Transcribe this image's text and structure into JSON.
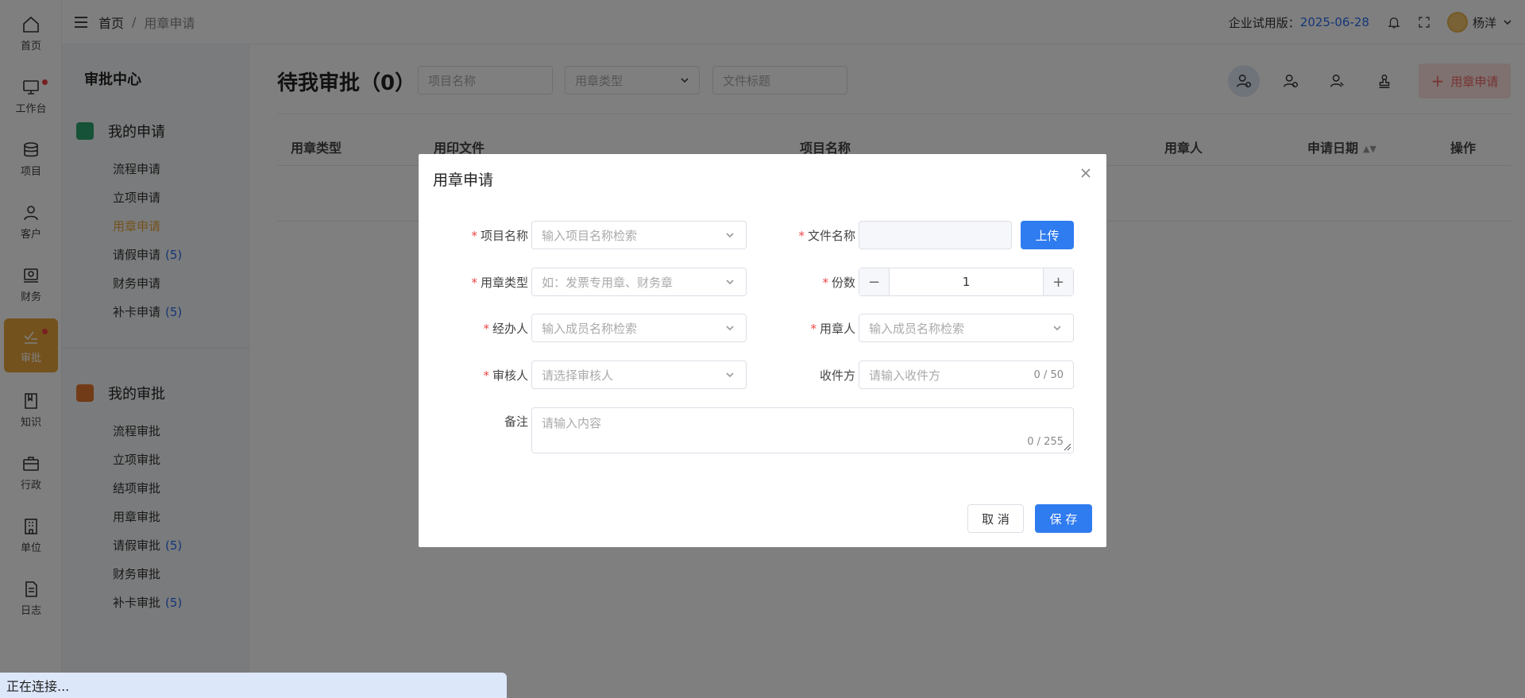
{
  "rail": {
    "items": [
      {
        "label": "首页",
        "icon": "home-icon"
      },
      {
        "label": "工作台",
        "icon": "monitor-icon"
      },
      {
        "label": "项目",
        "icon": "database-icon"
      },
      {
        "label": "客户",
        "icon": "user-icon"
      },
      {
        "label": "财务",
        "icon": "finance-icon"
      },
      {
        "label": "审批",
        "icon": "approve-icon"
      },
      {
        "label": "知识",
        "icon": "book-icon"
      },
      {
        "label": "行政",
        "icon": "briefcase-icon"
      },
      {
        "label": "单位",
        "icon": "building-icon"
      },
      {
        "label": "日志",
        "icon": "document-icon"
      }
    ]
  },
  "topbar": {
    "breadcrumb_home": "首页",
    "breadcrumb_sep": "/",
    "breadcrumb_current": "用章申请",
    "trial_label": "企业试用版：",
    "trial_date": "2025-06-28",
    "user_name": "杨洋"
  },
  "subnav": {
    "title": "审批中心",
    "my_applications": {
      "title": "我的申请",
      "items": [
        {
          "label": "流程申请"
        },
        {
          "label": "立项申请"
        },
        {
          "label": "用章申请"
        },
        {
          "label": "请假申请",
          "count": "(5)"
        },
        {
          "label": "财务申请"
        },
        {
          "label": "补卡申请",
          "count": "(5)"
        }
      ]
    },
    "my_approvals": {
      "title": "我的审批",
      "items": [
        {
          "label": "流程审批"
        },
        {
          "label": "立项审批"
        },
        {
          "label": "结项审批"
        },
        {
          "label": "用章审批"
        },
        {
          "label": "请假审批",
          "count": "(5)"
        },
        {
          "label": "财务审批"
        },
        {
          "label": "补卡审批",
          "count": "(5)"
        }
      ]
    }
  },
  "main": {
    "title": "待我审批（0）",
    "filters": {
      "project_name": "项目名称",
      "seal_type": "用章类型",
      "file_title": "文件标题"
    },
    "new_button": "用章申请",
    "columns": [
      "用章类型",
      "用印文件",
      "项目名称",
      "用章人",
      "申请日期",
      "操作"
    ]
  },
  "dialog": {
    "title": "用章申请",
    "fields": {
      "project_name": {
        "label": "项目名称",
        "placeholder": "输入项目名称检索"
      },
      "file_name": {
        "label": "文件名称",
        "upload": "上传"
      },
      "seal_type": {
        "label": "用章类型",
        "placeholder": "如：发票专用章、财务章"
      },
      "copies": {
        "label": "份数",
        "value": "1",
        "minus": "−",
        "plus": "+"
      },
      "handler": {
        "label": "经办人",
        "placeholder": "输入成员名称检索"
      },
      "seal_user": {
        "label": "用章人",
        "placeholder": "输入成员名称检索"
      },
      "reviewer": {
        "label": "审核人",
        "placeholder": "请选择审核人"
      },
      "recipient": {
        "label": "收件方",
        "placeholder": "请输入收件方",
        "counter": "0 / 50"
      },
      "remark": {
        "label": "备注",
        "placeholder": "请输入内容",
        "counter": "0 / 255"
      }
    },
    "cancel": "取 消",
    "save": "保 存"
  },
  "status": {
    "text": "正在连接..."
  },
  "colors": {
    "accent": "#e9a53b",
    "primary": "#2f7bf0",
    "required": "#f04545"
  }
}
